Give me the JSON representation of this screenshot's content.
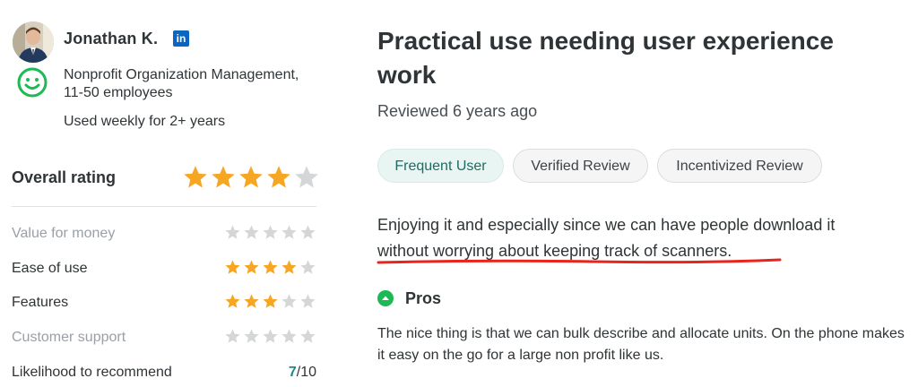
{
  "reviewer": {
    "name": "Jonathan K.",
    "linkedin_label": "in",
    "organization": "Nonprofit Organization Management, 11-50 employees",
    "usage": "Used weekly for 2+ years"
  },
  "overall": {
    "label": "Overall rating",
    "stars": 4,
    "out_of": 5
  },
  "ratings": [
    {
      "label": "Value for money",
      "stars": 0,
      "out_of": 5
    },
    {
      "label": "Ease of use",
      "stars": 4,
      "out_of": 5
    },
    {
      "label": "Features",
      "stars": 3,
      "out_of": 5
    },
    {
      "label": "Customer support",
      "stars": 0,
      "out_of": 5
    }
  ],
  "recommend": {
    "label": "Likelihood to recommend",
    "value": "7",
    "out_of": "/10"
  },
  "review": {
    "title": "Practical use needing user experience work",
    "reviewed": "Reviewed 6 years ago",
    "badges": [
      "Frequent User",
      "Verified Review",
      "Incentivized Review"
    ],
    "body": "Enjoying it and especially since we can have people download it without worrying about keeping track of scanners.",
    "pros_label": "Pros",
    "pros_text": "The nice thing is that we can bulk describe and allocate units. On the phone makes it easy on the go for a large non profit like us."
  },
  "colors": {
    "star_filled": "#f6a623",
    "star_empty": "#d4d6d8",
    "accent_green": "#1db954",
    "annotation_red": "#e8241c",
    "linkedin": "#0a66c2"
  },
  "icons": [
    "avatar-photo",
    "linkedin-icon",
    "smiley-icon",
    "star-icon",
    "chevron-up-circle-icon"
  ]
}
